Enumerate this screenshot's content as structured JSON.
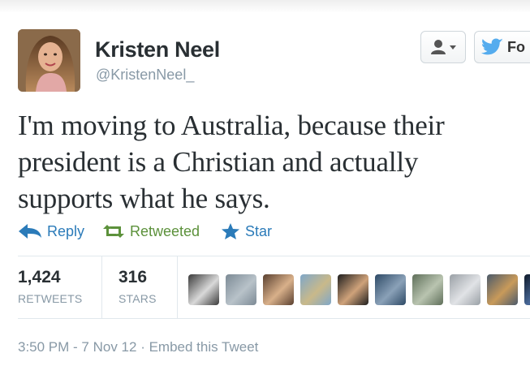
{
  "user": {
    "full_name": "Kristen Neel",
    "screen_name": "@KristenNeel_"
  },
  "header_buttons": {
    "follow_label": "Fo"
  },
  "tweet": {
    "lines": [
      "I'm moving to Australia, because their",
      "president is a Christian and actually",
      "supports what he says."
    ]
  },
  "actions": {
    "reply": "Reply",
    "retweeted": "Retweeted",
    "star": "Star"
  },
  "stats": {
    "retweets_count": "1,424",
    "retweets_label": "RETWEETS",
    "stars_count": "316",
    "stars_label": "STARS"
  },
  "favoriter_avatars": [
    {
      "name": "avatar-1",
      "colors": [
        "#3a3a3a",
        "#d9d9d9"
      ]
    },
    {
      "name": "avatar-2",
      "colors": [
        "#7c8a95",
        "#b8c2c9"
      ]
    },
    {
      "name": "avatar-3",
      "colors": [
        "#5a4030",
        "#d8b08a"
      ]
    },
    {
      "name": "avatar-4",
      "colors": [
        "#7fa7c9",
        "#c9b98a"
      ]
    },
    {
      "name": "avatar-5",
      "colors": [
        "#1e1e1e",
        "#cfa27a"
      ]
    },
    {
      "name": "avatar-6",
      "colors": [
        "#2e4a66",
        "#8aa1b8"
      ]
    },
    {
      "name": "avatar-7",
      "colors": [
        "#5f6f5a",
        "#b9c4b0"
      ]
    },
    {
      "name": "avatar-8",
      "colors": [
        "#9aa0a6",
        "#e1e3e6"
      ]
    },
    {
      "name": "avatar-9",
      "colors": [
        "#4b5a6b",
        "#c89a5a"
      ]
    },
    {
      "name": "avatar-10",
      "colors": [
        "#0f1a2a",
        "#4a6a9a"
      ]
    }
  ],
  "footer": {
    "timestamp": "3:50 PM - 7 Nov 12",
    "separator": " · ",
    "embed_link": "Embed this Tweet"
  },
  "colors": {
    "link_blue": "#2b7bb9",
    "retweet_green": "#5c913b",
    "muted_gray": "#8899a6",
    "twitter_bird": "#55acee"
  }
}
